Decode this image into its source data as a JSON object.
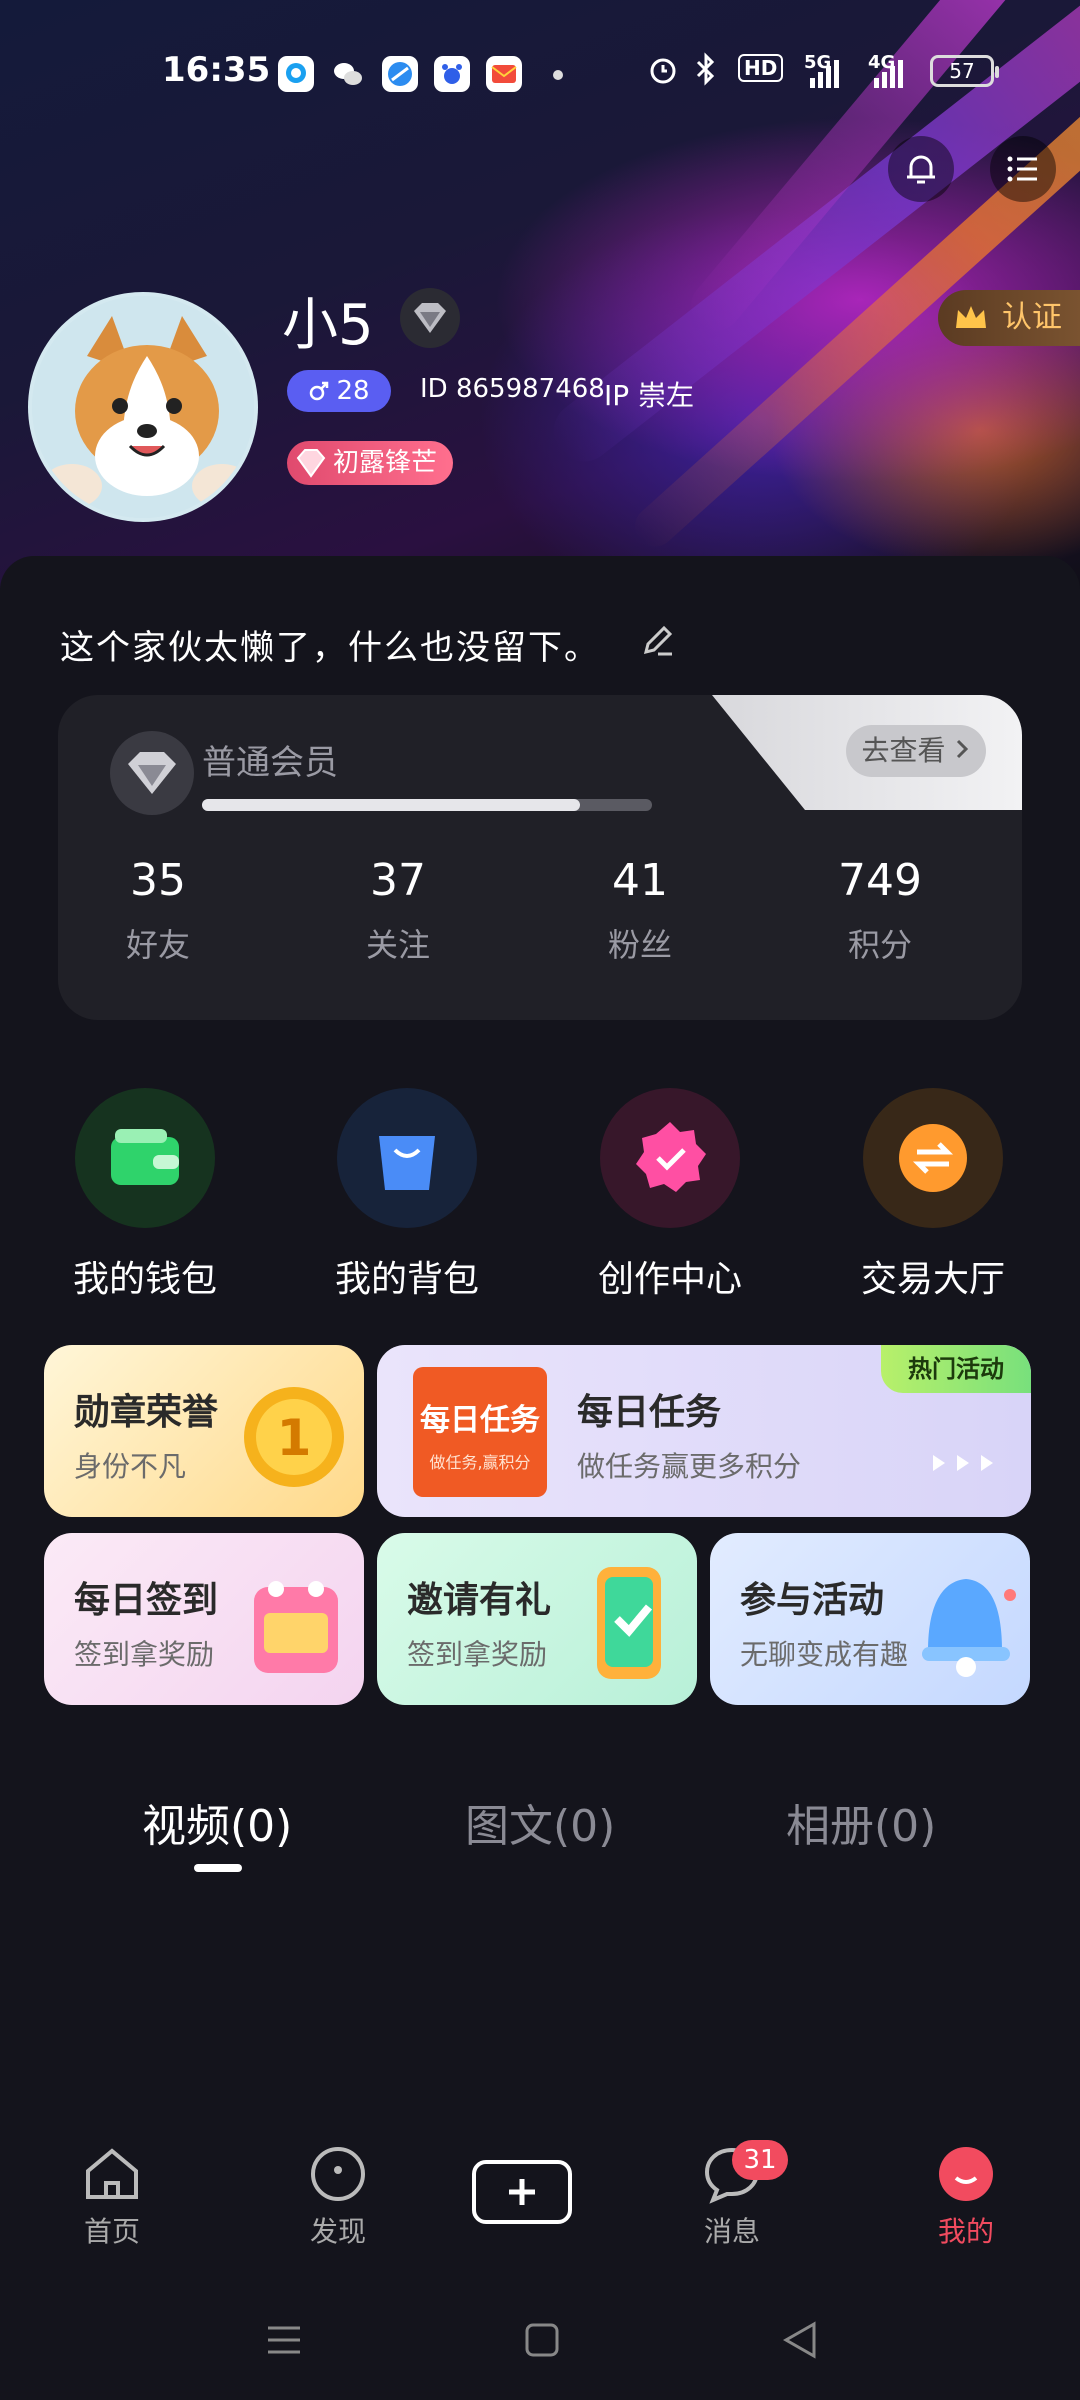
{
  "status_bar": {
    "time": "16:35",
    "battery": "57",
    "hd_label": "HD",
    "net1": "5G",
    "net2": "4G"
  },
  "profile": {
    "username": "小5",
    "gender_age": "28",
    "id_text": "ID 865987468",
    "ip_text": "IP 崇左",
    "level_badge": "初露锋芒",
    "cert_label": "认证",
    "bio": "这个家伙太懒了，什么也没留下。"
  },
  "member": {
    "label": "普通会员",
    "view_label": "去查看",
    "progress": 0.84,
    "stats": [
      {
        "num": "35",
        "label": "好友"
      },
      {
        "num": "37",
        "label": "关注"
      },
      {
        "num": "41",
        "label": "粉丝"
      },
      {
        "num": "749",
        "label": "积分"
      }
    ]
  },
  "quick_actions": [
    {
      "label": "我的钱包",
      "icon": "wallet-icon",
      "color": "#2fd36b"
    },
    {
      "label": "我的背包",
      "icon": "bag-icon",
      "color": "#4a8cf7"
    },
    {
      "label": "创作中心",
      "icon": "creator-badge-icon",
      "color": "#ff4fa3"
    },
    {
      "label": "交易大厅",
      "icon": "exchange-icon",
      "color": "#ff9a2e"
    }
  ],
  "promos": {
    "medal": {
      "title": "勋章荣誉",
      "sub": "身份不凡"
    },
    "daily_task": {
      "title": "每日任务",
      "sub": "做任务赢更多积分",
      "logo_main": "每日任务",
      "logo_sub": "做任务,赢积分",
      "hot_tag": "热门活动"
    },
    "signin": {
      "title": "每日签到",
      "sub": "签到拿奖励"
    },
    "invite": {
      "title": "邀请有礼",
      "sub": "签到拿奖励"
    },
    "activity": {
      "title": "参与活动",
      "sub": "无聊变成有趣"
    }
  },
  "content_tabs": [
    {
      "label": "视频(0)",
      "active": true
    },
    {
      "label": "图文(0)",
      "active": false
    },
    {
      "label": "相册(0)",
      "active": false
    }
  ],
  "bottom_nav": {
    "items": [
      {
        "label": "首页",
        "icon": "home-icon"
      },
      {
        "label": "发现",
        "icon": "discover-icon"
      },
      {
        "label": "",
        "icon": "plus-icon"
      },
      {
        "label": "消息",
        "icon": "message-icon"
      },
      {
        "label": "我的",
        "icon": "profile-icon"
      }
    ],
    "message_badge": "31",
    "accent": "#f24b5f"
  }
}
